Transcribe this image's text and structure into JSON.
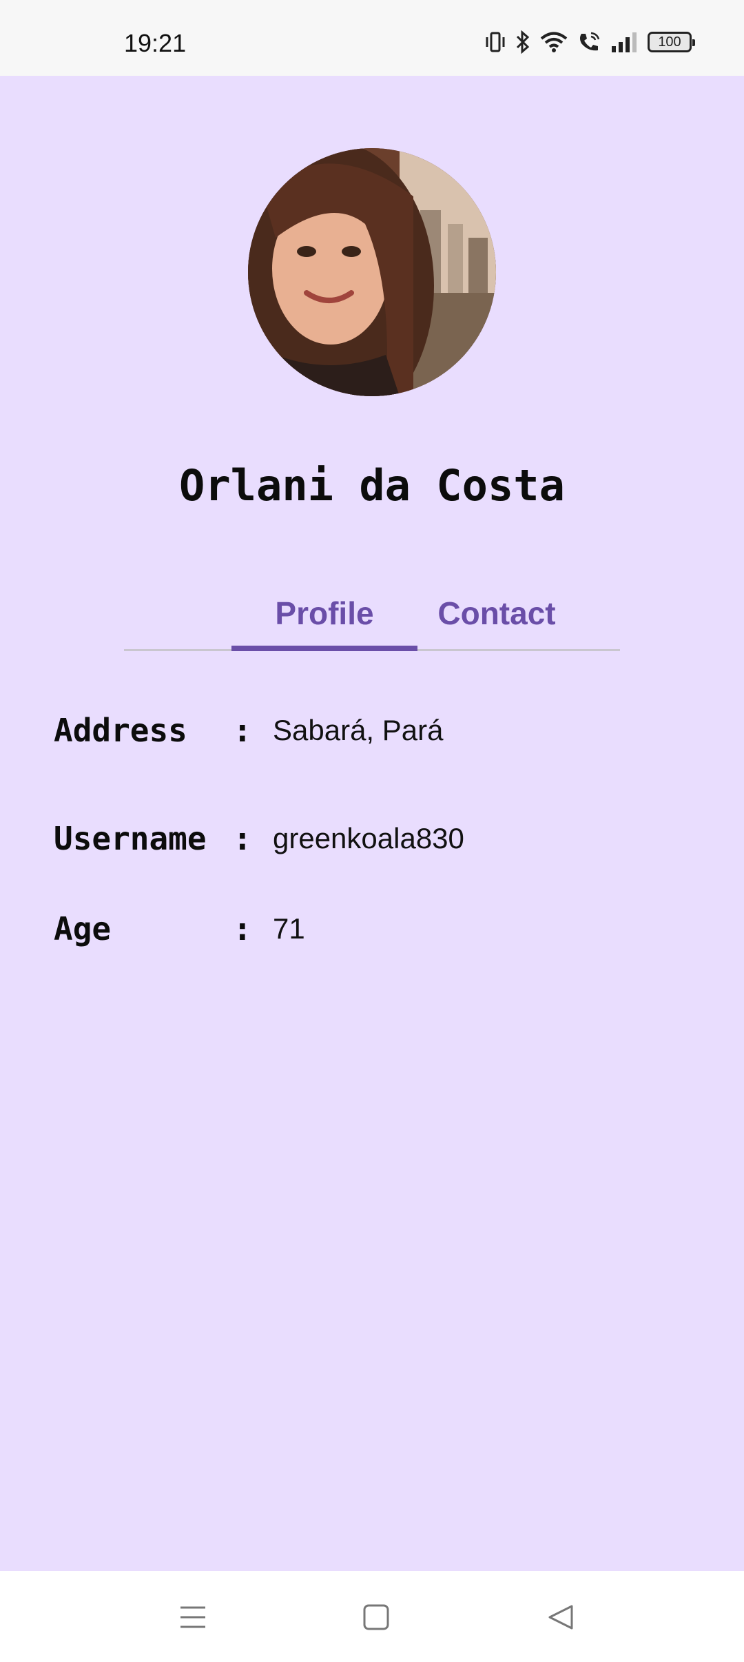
{
  "status_bar": {
    "time": "19:21",
    "battery": "100",
    "icons": [
      "vibrate-icon",
      "bluetooth-icon",
      "wifi-icon",
      "wifi-calling-icon",
      "signal-icon",
      "battery-icon"
    ]
  },
  "profile": {
    "name": "Orlani da Costa",
    "avatar_icon": "profile-photo"
  },
  "tabs": [
    {
      "label": "Profile",
      "selected": true
    },
    {
      "label": "Contact",
      "selected": false
    }
  ],
  "details": [
    {
      "label": "Address",
      "separator": ":",
      "value": "Sabará, Pará"
    },
    {
      "label": "Username",
      "separator": ":",
      "value": "greenkoala830"
    },
    {
      "label": "Age",
      "separator": ":",
      "value": "71"
    }
  ],
  "colors": {
    "background": "#e9ddfe",
    "accent": "#6a4ea8",
    "status_bar": "#f7f7f7",
    "nav_bar": "#ffffff"
  },
  "nav_bar": {
    "icons": [
      "menu-icon",
      "home-icon",
      "back-icon"
    ]
  }
}
